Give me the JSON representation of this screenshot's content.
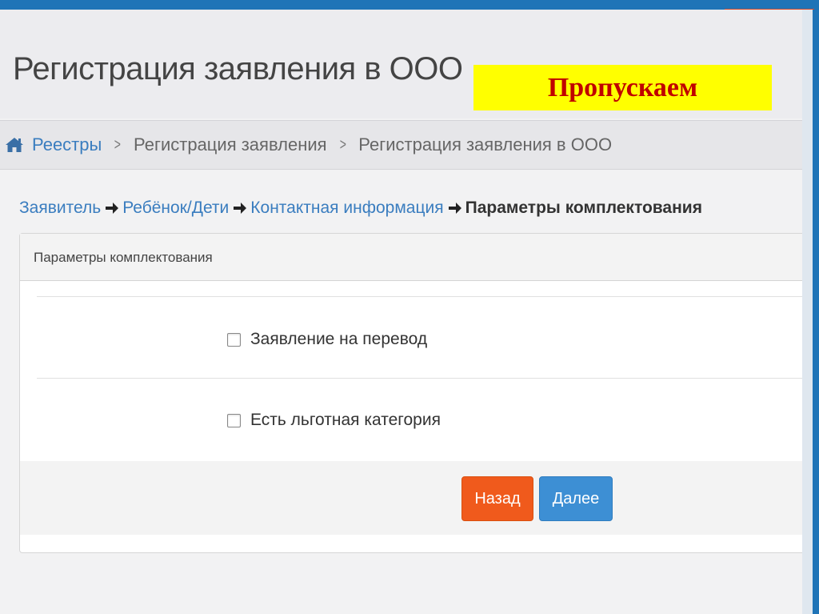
{
  "page": {
    "title": "Регистрация заявления в ООО",
    "skip_label": "Пропускаем"
  },
  "breadcrumb": {
    "home_icon": "home-icon",
    "items": [
      {
        "label": "Реестры"
      },
      {
        "label": "Регистрация заявления"
      },
      {
        "label": "Регистрация заявления в ООО"
      }
    ]
  },
  "steps": {
    "items": [
      {
        "label": "Заявитель"
      },
      {
        "label": "Ребёнок/Дети"
      },
      {
        "label": "Контактная информация"
      },
      {
        "label": "Параметры комплектования"
      }
    ]
  },
  "panel": {
    "heading": "Параметры комплектования",
    "checkboxes": [
      {
        "label": "Заявление на перевод",
        "checked": false
      },
      {
        "label": "Есть льготная категория",
        "checked": false
      }
    ]
  },
  "buttons": {
    "back_label": "Назад",
    "next_label": "Далее"
  },
  "colors": {
    "brand_blue": "#1f74b7",
    "link": "#3a7dbf",
    "back_button": "#f05a1c",
    "next_button": "#3d8fd4",
    "banner_bg": "#ffff00",
    "banner_text": "#c00000"
  }
}
